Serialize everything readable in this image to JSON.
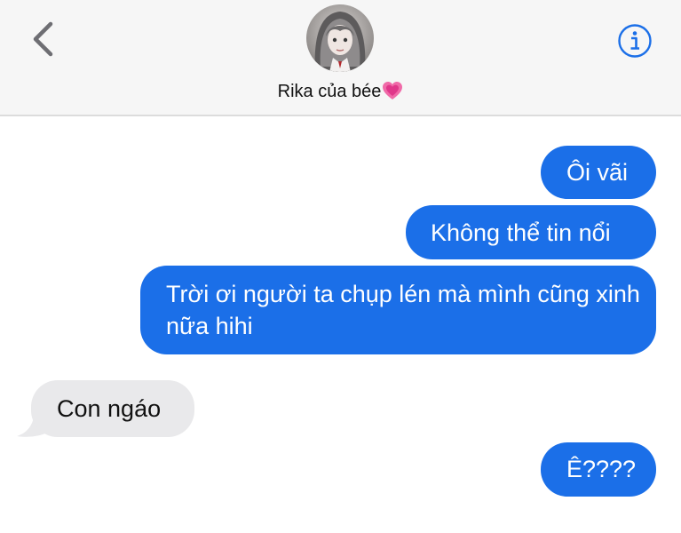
{
  "header": {
    "back_icon": "chevron-left-icon",
    "contact_name": "Rika của bée",
    "contact_emoji": "growing-heart-icon",
    "info_icon": "info-circle-icon",
    "accent_color": "#1b6fe8"
  },
  "messages": [
    {
      "direction": "outgoing",
      "text": "Ôi vãi"
    },
    {
      "direction": "outgoing",
      "text": "Không thể tin nổi"
    },
    {
      "direction": "outgoing",
      "text": "Trời ơi người ta chụp lén mà mình cũng xinh nữa hihi"
    },
    {
      "direction": "incoming",
      "text": "Con ngáo"
    },
    {
      "direction": "outgoing",
      "text": "Ê????"
    }
  ],
  "colors": {
    "outgoing_bubble": "#1b6fe8",
    "incoming_bubble": "#e9e9eb"
  }
}
